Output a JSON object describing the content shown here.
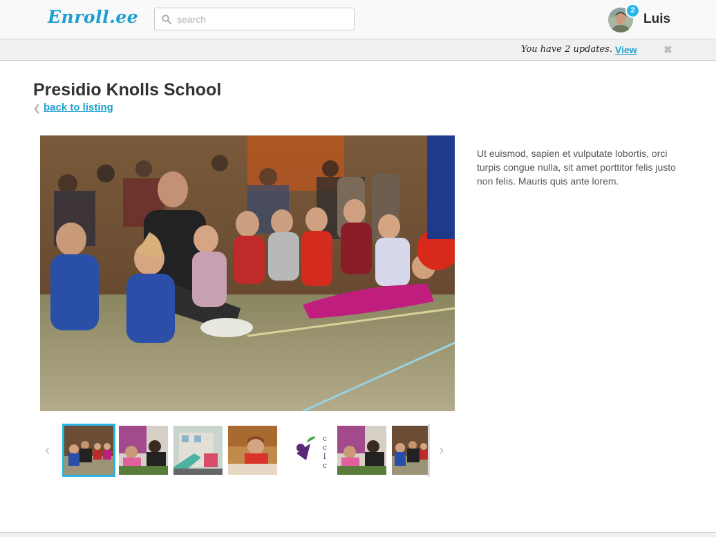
{
  "header": {
    "logo_text": "Enroll.ee",
    "search_placeholder": "search",
    "user_name": "Luis",
    "notification_count": "2"
  },
  "notification": {
    "text": "You have 2 updates.",
    "link_label": "View",
    "close_glyph": "✖"
  },
  "listing": {
    "title": "Presidio Knolls School",
    "back_label": "back to listing",
    "description": "Ut euismod, sapien et vulputate lobortis, orci turpis congue nulla, sit amet porttitor felis justo non felis. Mauris quis ante lorem."
  },
  "carousel": {
    "prev_glyph": "‹",
    "next_glyph": "›",
    "active_index": 0,
    "thumbnails": [
      {
        "name": "thumb-classroom-floor"
      },
      {
        "name": "thumb-children-pink"
      },
      {
        "name": "thumb-playground"
      },
      {
        "name": "thumb-child-crafts"
      },
      {
        "name": "thumb-cclc-logo",
        "logo_text": "cclc"
      },
      {
        "name": "thumb-children-pink-2"
      },
      {
        "name": "thumb-classroom-floor-2"
      }
    ]
  },
  "colors": {
    "accent": "#1e9fd0",
    "badge": "#29b6e6"
  }
}
